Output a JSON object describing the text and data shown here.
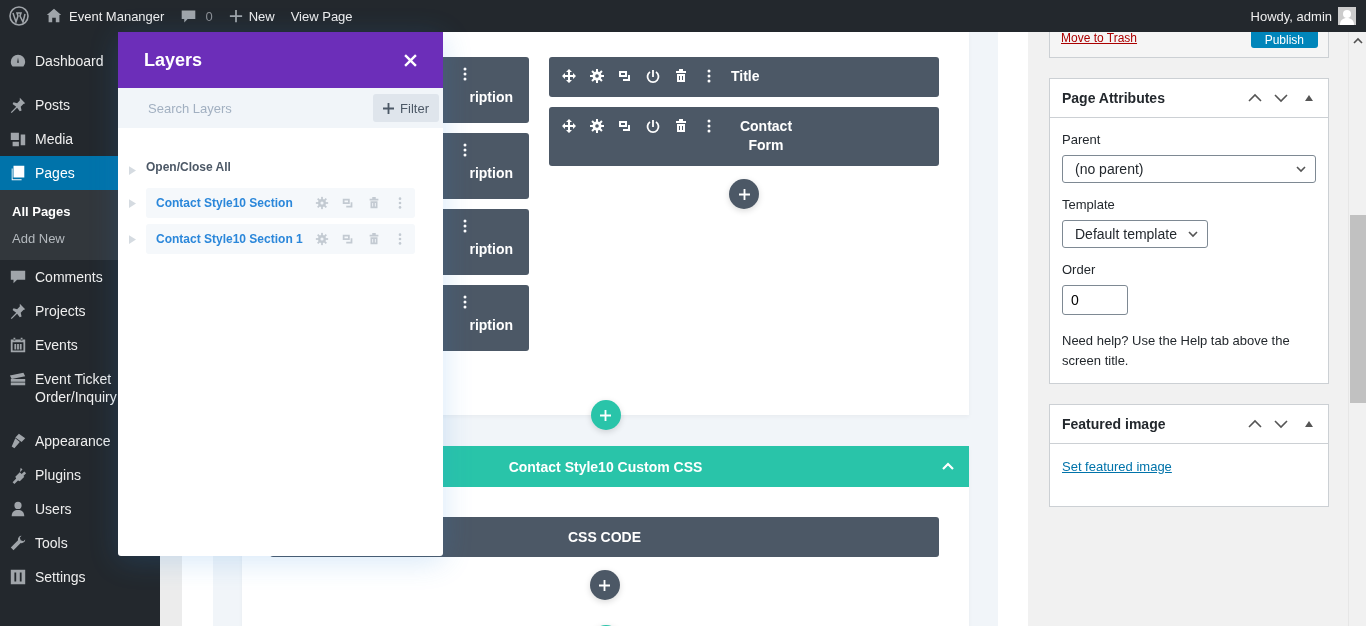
{
  "admin_bar": {
    "site_name": "Event Mananger",
    "comment_count": "0",
    "new_label": "New",
    "view_label": "View Page",
    "greeting": "Howdy, admin"
  },
  "sidebar": {
    "items": [
      {
        "label": "Dashboard",
        "selected": false
      },
      {
        "label": "Posts",
        "selected": false
      },
      {
        "label": "Media",
        "selected": false
      },
      {
        "label": "Pages",
        "selected": true,
        "children": [
          {
            "label": "All Pages",
            "selected": true
          },
          {
            "label": "Add New",
            "selected": false
          }
        ]
      },
      {
        "label": "Comments",
        "selected": false
      },
      {
        "label": "Projects",
        "selected": false
      },
      {
        "label": "Events",
        "selected": false
      },
      {
        "label": "Event Ticket Order/Inquiry",
        "selected": false
      },
      {
        "label": "Appearance",
        "selected": false
      },
      {
        "label": "Plugins",
        "selected": false
      },
      {
        "label": "Users",
        "selected": false
      },
      {
        "label": "Tools",
        "selected": false
      },
      {
        "label": "Settings",
        "selected": false
      }
    ]
  },
  "layers_panel": {
    "title": "Layers",
    "search": {
      "placeholder": "Search Layers"
    },
    "filter_label": "Filter",
    "toggle_all": "Open/Close All",
    "layers": [
      {
        "label": "Contact Style10 Section",
        "expanded": false
      },
      {
        "label": "Contact Style10 Section 1",
        "expanded": false
      }
    ]
  },
  "builder": {
    "section_1": {
      "left_modules": [
        {
          "label": "ription"
        },
        {
          "label": "ription"
        },
        {
          "label": "ription"
        },
        {
          "label": "ription"
        }
      ],
      "right_modules": [
        {
          "label": "Title"
        },
        {
          "label": "Contact Form"
        }
      ]
    },
    "section_2": {
      "title": "Contact Style10 Custom CSS",
      "expanded": true,
      "modules": [
        {
          "label": "CSS CODE"
        }
      ]
    }
  },
  "publish_box": {
    "trash_link": "Move to Trash",
    "publish_button": "Publish"
  },
  "page_attributes": {
    "title": "Page Attributes",
    "expanded": true,
    "parent_label": "Parent",
    "parent_value": "(no parent)",
    "template_label": "Template",
    "template_value": "Default template",
    "order_label": "Order",
    "order_value": "0",
    "help": "Need help? Use the Help tab above the screen title."
  },
  "featured_image": {
    "title": "Featured image",
    "expanded": true,
    "link": "Set featured image"
  }
}
